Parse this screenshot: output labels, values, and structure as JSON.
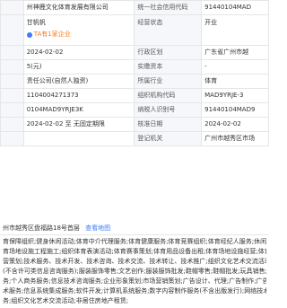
{
  "rows": [
    {
      "l1": "",
      "v1": "州神鹿文化体育发展有限公司",
      "l2": "统一社会信用代码",
      "v2": "91440104MAD"
    },
    {
      "l1": "",
      "v1": "",
      "l2": "经营状态",
      "v2": "开业"
    },
    {
      "l1": "",
      "v1": "2024-02-02",
      "l2": "行政区划",
      "v2": "广东省广州市越"
    },
    {
      "l1": "",
      "v1": "5(元)",
      "l2": "实缴资本",
      "v2": "-"
    },
    {
      "l1": "",
      "v1": "责任公司(自然人独资)",
      "l2": "所属行业",
      "v2": "体育"
    },
    {
      "l1": "",
      "v1": "1104004271373",
      "l2": "组织机构代码",
      "v2": "MAD9YRJE-3"
    },
    {
      "l1": "",
      "v1": "0104MAD9YRJE3K",
      "l2": "纳税人识别号",
      "v2": "91440104MAD9"
    },
    {
      "l1": "",
      "v1": "2024-02-02 至 无固定期限",
      "l2": "核准日期",
      "v2": "2024-02-02"
    },
    {
      "l1": "",
      "v1": "",
      "l2": "登记机关",
      "v2": "广州市越秀区市场"
    }
  ],
  "legal_rep": {
    "name": "甘帆帆",
    "badge": "TA有1家企业"
  },
  "address": {
    "text": "州市越秀区盘福路18号首层",
    "link": "查看地图"
  },
  "scope_lines": [
    "育保障组织;健身休闲活动;体育中介代理服务;体育健康服务;体育竞赛组织;体育经纪人服务;休闲观光活动",
    "育场地设施工程施工;组织体育表演活动;体育赛事策划;体育用品设备出租;体育场地设施经营;体育用品及器",
    "营策划;技术服务、技术开发、技术咨询、技术交流、技术转让、技术推广;组织文化艺术交流活动;文艺创作;",
    "(不含许可类信息咨询服务);服装服饰零售;文艺创作;服装服饰批发;鞋帽零售;鞋帽批发;玩具销售;会议及",
    "务;个人商务服务;信息技术咨询服务;企业形象策划;市场营销策划;广告设计、代理;广告制作;广告发布;",
    "术服务;信息系统集成服务;软件开发;计算机系统服务;数字内容制作服务(不含出版发行);网络技术服务;",
    "务;组织文化艺术交流活动;非居住房地产租赁;"
  ],
  "colors": {
    "label_bg": "#f5f7fa",
    "border": "#e6e6e6",
    "link": "#3e7bfa",
    "badge": "#ff7a1a"
  }
}
